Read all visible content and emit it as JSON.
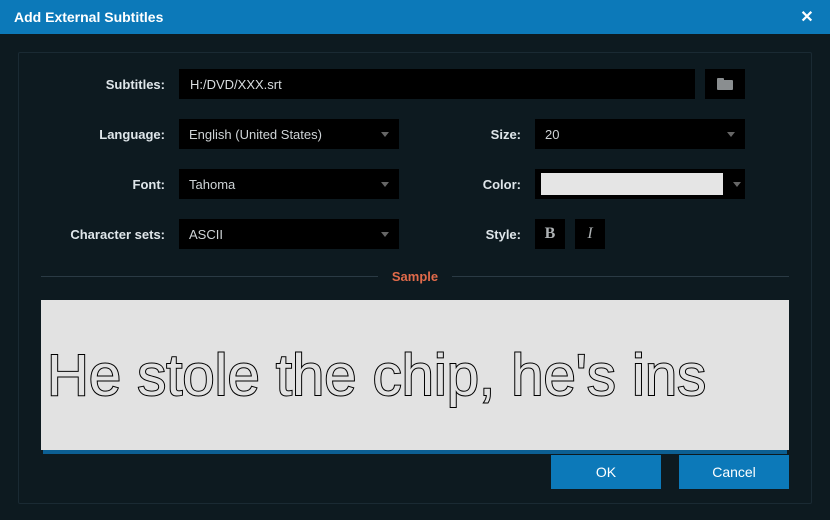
{
  "window": {
    "title": "Add External Subtitles"
  },
  "labels": {
    "subtitles": "Subtitles:",
    "language": "Language:",
    "font": "Font:",
    "charsets": "Character sets:",
    "size": "Size:",
    "color": "Color:",
    "style": "Style:"
  },
  "fields": {
    "subtitlePath": "H:/DVD/XXX.srt",
    "language": "English (United States)",
    "font": "Tahoma",
    "charsets": "ASCII",
    "size": "20",
    "colorHex": "#e5e5e5"
  },
  "sample": {
    "heading": "Sample",
    "text": "He stole the chip, he's ins"
  },
  "buttons": {
    "ok": "OK",
    "cancel": "Cancel",
    "bold": "B",
    "italic": "I"
  }
}
